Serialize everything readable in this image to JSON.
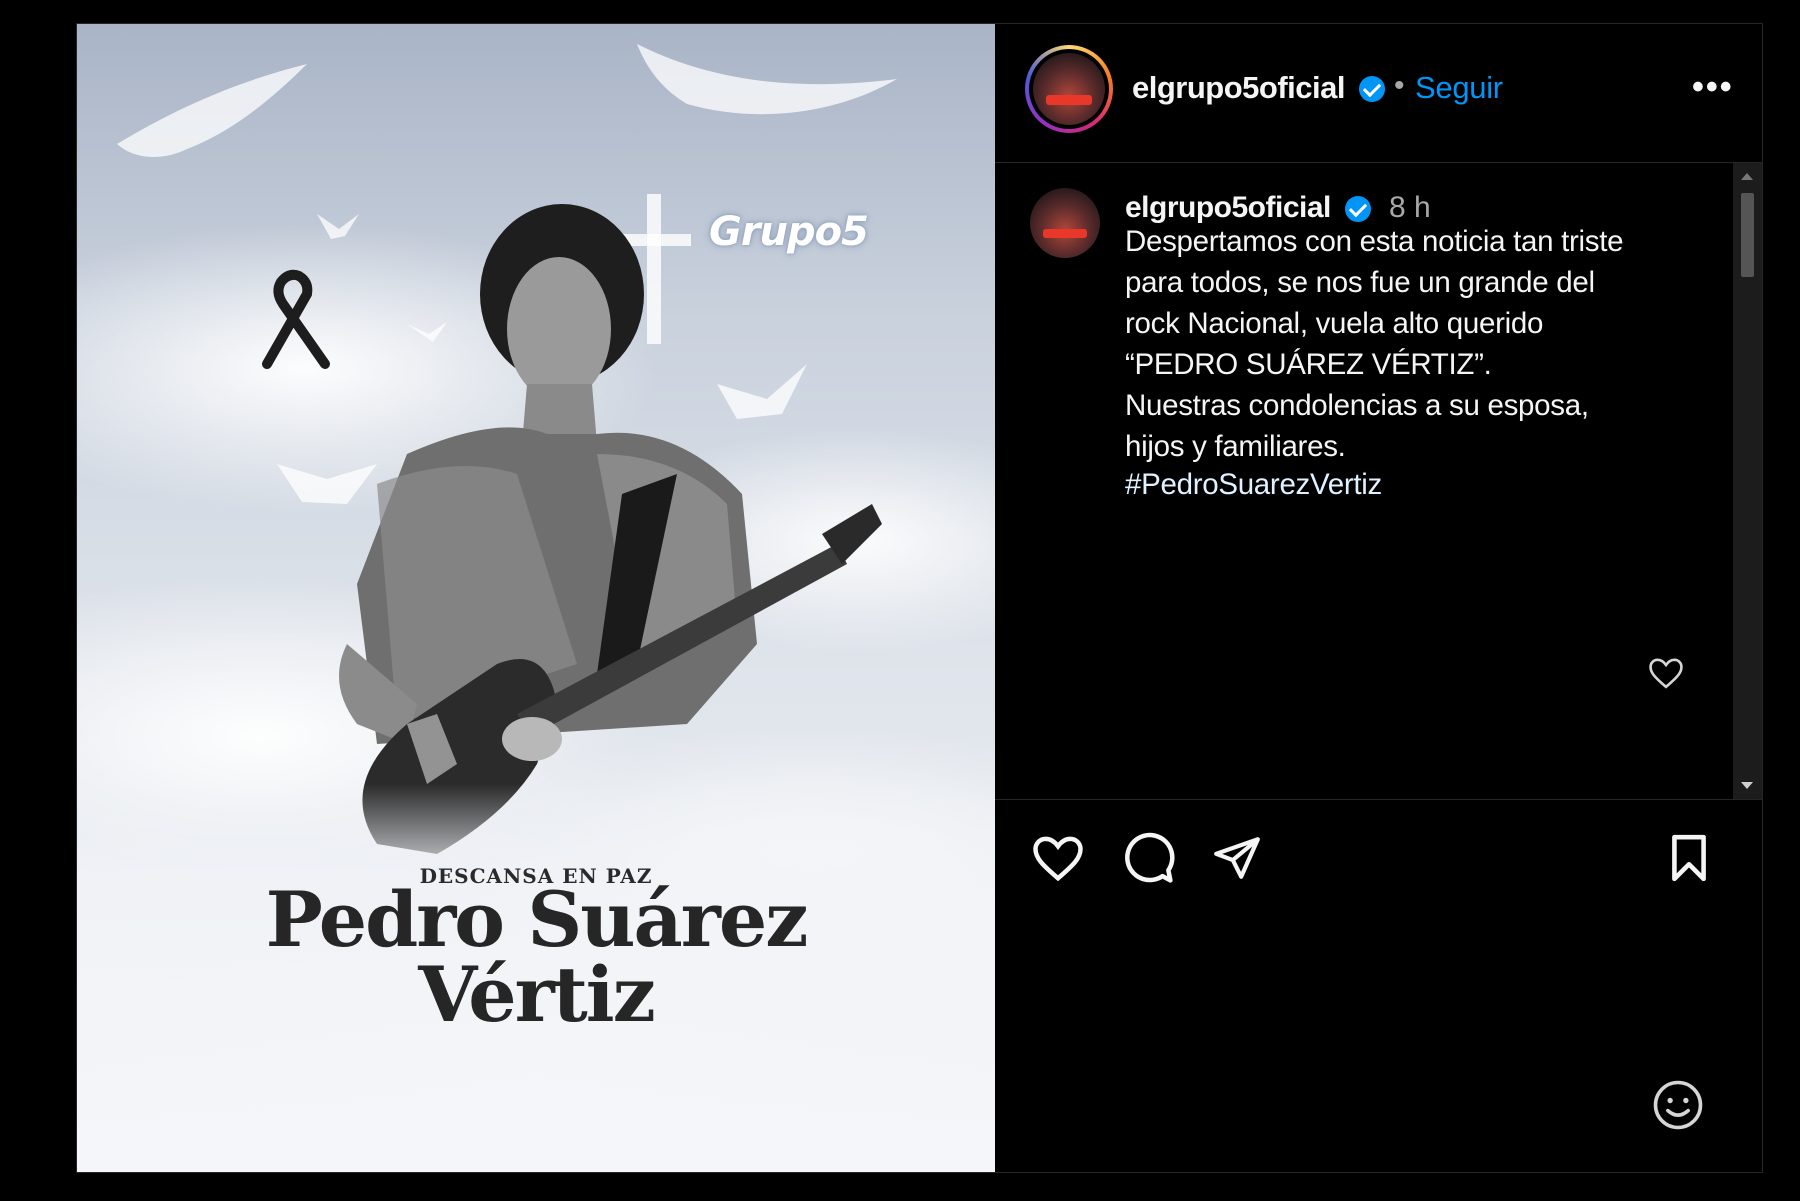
{
  "post": {
    "image": {
      "subtitle": "DESCANSA EN PAZ",
      "name_line1": "Pedro Suárez",
      "name_line2": "Vértiz",
      "logo_text": "Grupo5"
    },
    "header": {
      "username": "elgrupo5oficial",
      "separator": "•",
      "follow_label": "Seguir",
      "more_label": "•••"
    },
    "caption": {
      "username": "elgrupo5oficial",
      "time": "8 h",
      "text": "Despertamos con esta noticia tan triste\npara todos, se nos fue un grande del\nrock Nacional, vuela alto querido\n“PEDRO SUÁREZ VÉRTIZ”.\nNuestras condolencias a su esposa,\nhijos y familiares.",
      "hashtag": "#PedroSuarezVertiz"
    },
    "actions": [
      "like-icon",
      "comment-icon",
      "share-icon",
      "save-icon"
    ],
    "colors": {
      "accent": "#0095f6",
      "background": "#000000",
      "text": "#f5f5f5",
      "muted": "#a8a8a8"
    }
  }
}
